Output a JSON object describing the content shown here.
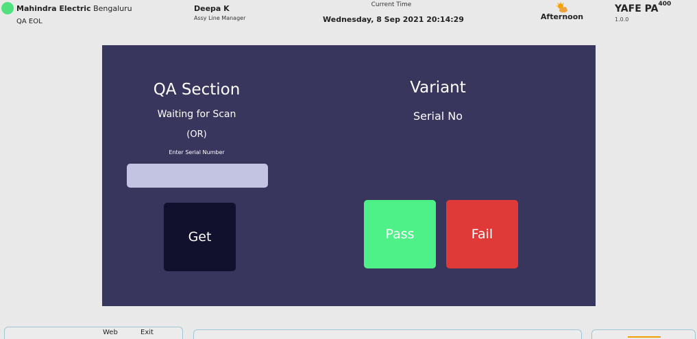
{
  "header": {
    "company_bold": "Mahindra Electric",
    "company_location": "Bengaluru",
    "station": "QA EOL",
    "user_name": "Deepa K",
    "user_role": "Assy Line Manager",
    "time_label": "Current Time",
    "time_value": "Wednesday, 8 Sep 2021 20:14:29",
    "weather_icon": "partly-cloudy-icon",
    "shift": "Afternoon",
    "app_name": "YAFE PA",
    "app_superscript": "400",
    "app_version": "1.0.0",
    "status_color": "#4fe17d"
  },
  "qa": {
    "section_title": "QA Section",
    "scan_status": "Waiting for Scan",
    "or_text": "(OR)",
    "serial_label": "Enter Serial Number",
    "serial_value": "",
    "get_label": "Get"
  },
  "result": {
    "variant": "Variant",
    "serial_no": "Serial No",
    "pass_label": "Pass",
    "fail_label": "Fail",
    "pass_color": "#4ef188",
    "fail_color": "#e03a38"
  },
  "footer": {
    "web_label": "Web",
    "exit_label": "Exit"
  },
  "colors": {
    "panel_bg": "#39365d",
    "input_bg": "#c3c4e2",
    "get_bg": "#12112d",
    "page_bg": "#e9e9e9"
  }
}
